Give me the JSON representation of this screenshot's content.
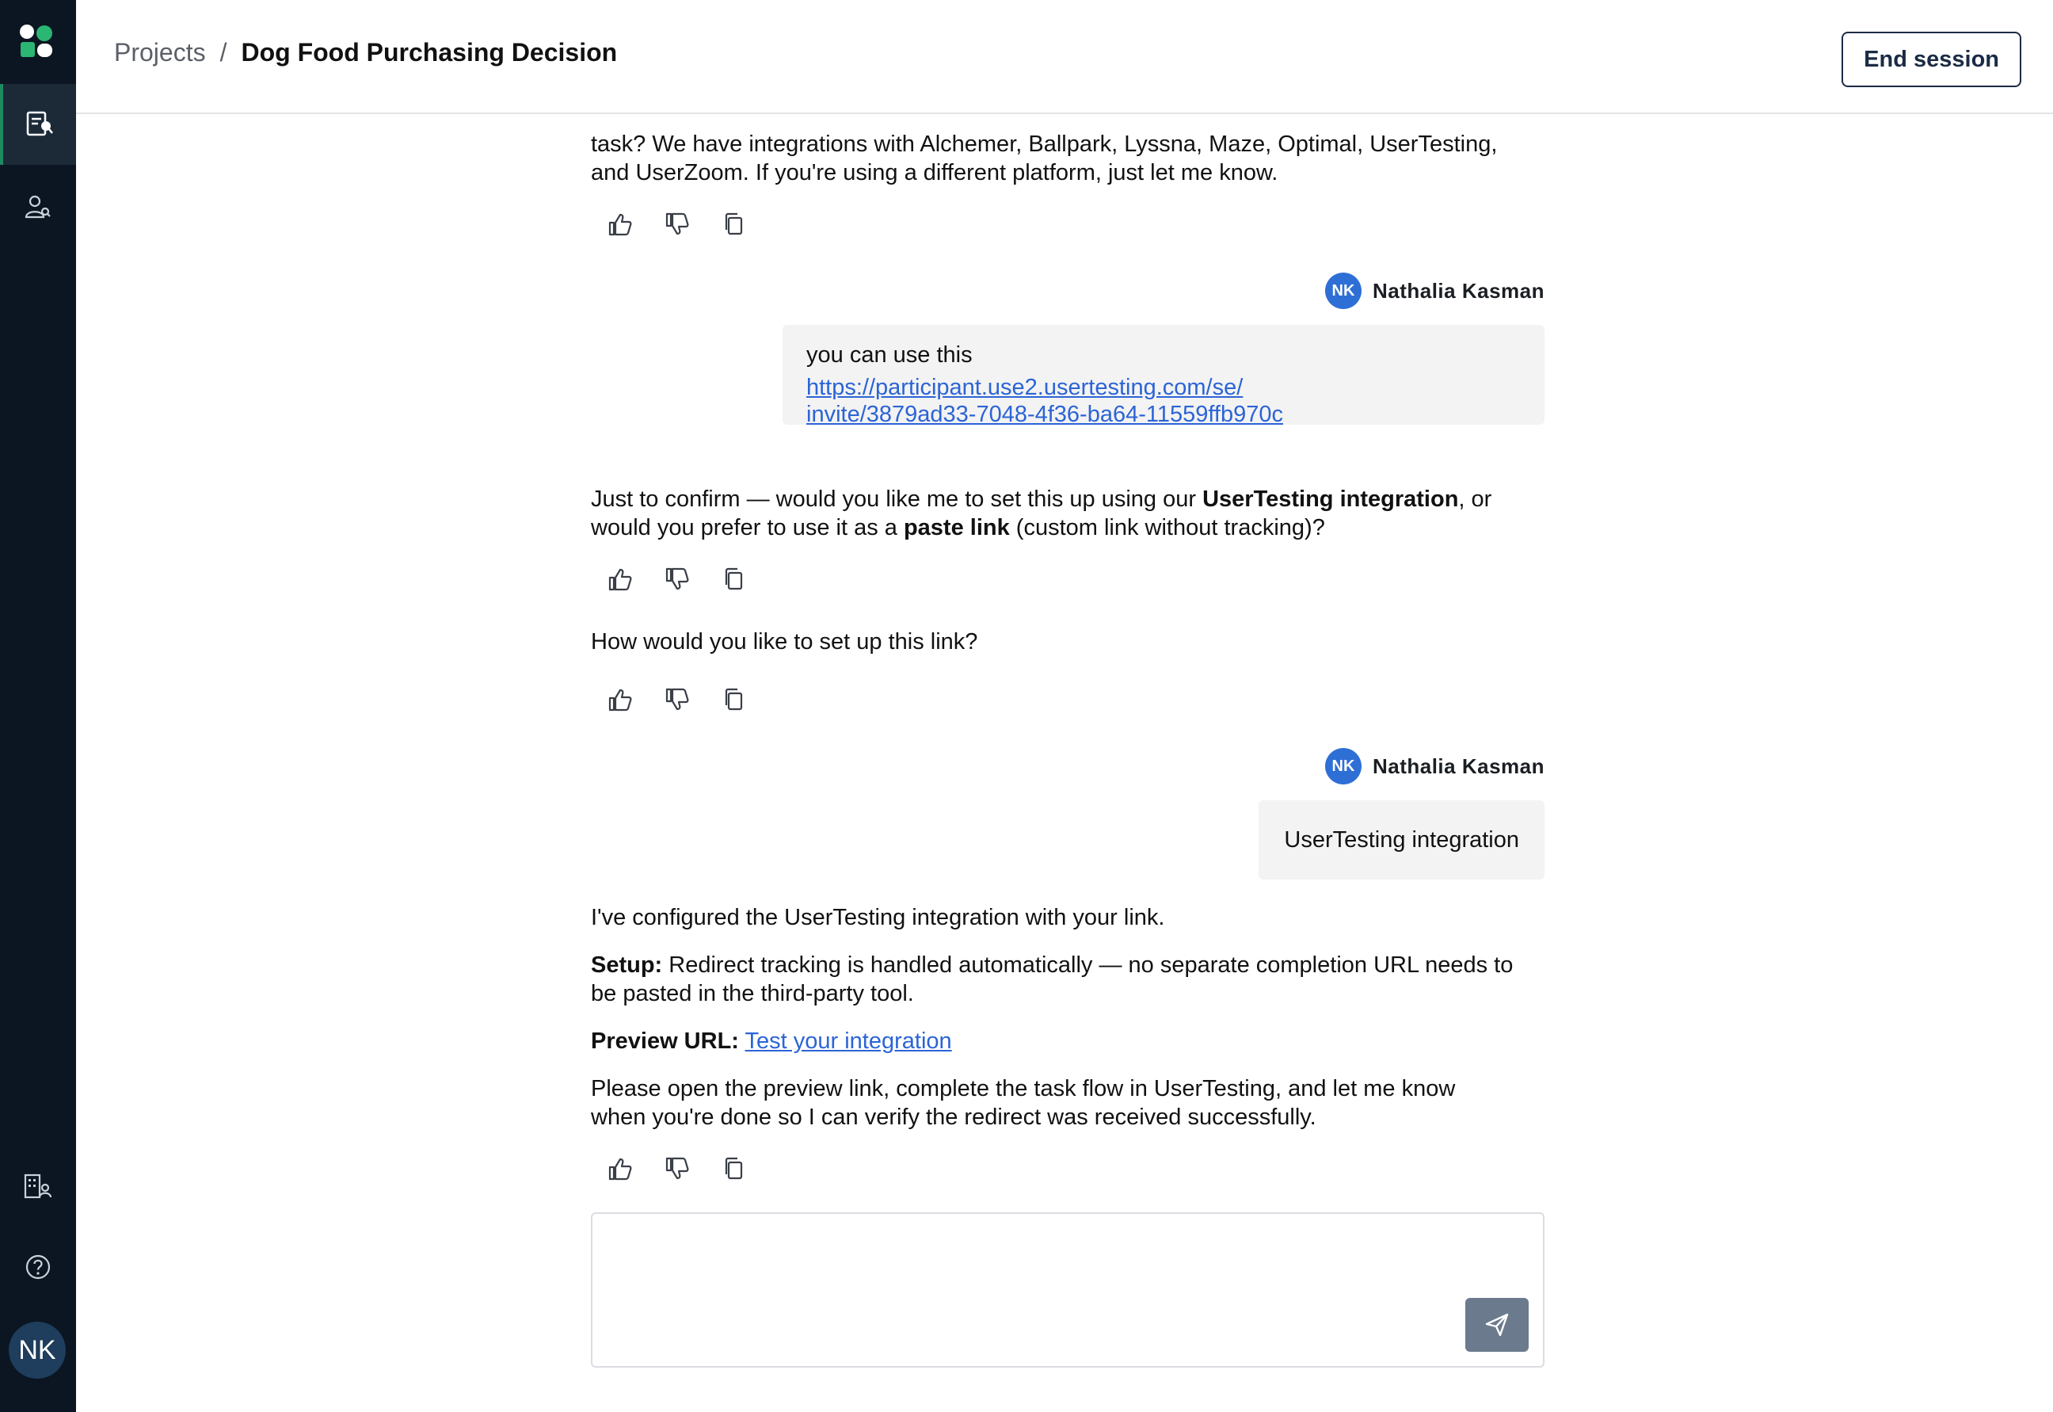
{
  "header": {
    "breadcrumb_root": "Projects",
    "breadcrumb_separator": "/",
    "title": "Dog Food Purchasing Decision",
    "end_session_label": "End session"
  },
  "sidebar": {
    "items": [
      {
        "icon": "studies-icon",
        "active": true
      },
      {
        "icon": "participants-icon",
        "active": false
      },
      {
        "icon": "organization-icon",
        "active": false
      },
      {
        "icon": "help-icon",
        "active": false
      }
    ],
    "avatar_initials": "NK"
  },
  "chat": {
    "msg1": {
      "line1": "task? We have integrations with Alchemer, Ballpark, Lyssna, Maze, Optimal, UserTesting,",
      "line2": "and UserZoom. If you're using a different platform, just let me know."
    },
    "user1": {
      "initials": "NK",
      "name": "Nathalia Kasman",
      "text": "you can use this",
      "link_line1": "https://participant.use2.usertesting.com/se/",
      "link_line2": "invite/3879ad33-7048-4f36-ba64-11559ffb970c"
    },
    "msg2": {
      "p1": "Just to confirm — would you like me to set this up using our ",
      "b1": "UserTesting integration",
      "p2": ", or",
      "p3": "would you prefer to use it as a ",
      "b2": "paste link",
      "p4": " (custom link without tracking)?"
    },
    "msg3": {
      "text": "How would you like to set up this link?"
    },
    "user2": {
      "initials": "NK",
      "name": "Nathalia Kasman",
      "text": "UserTesting integration"
    },
    "msg4": {
      "intro": "I've configured the UserTesting integration with your link.",
      "setup_label": "Setup:",
      "setup_line1": " Redirect tracking is handled automatically — no separate completion URL needs to",
      "setup_line2": "be pasted in the third-party tool.",
      "preview_label": "Preview URL:",
      "preview_link": "Test your integration",
      "outro_line1": "Please open the preview link, complete the task flow in UserTesting, and let me know",
      "outro_line2": "when you're done so I can verify the redirect was received successfully."
    }
  },
  "input": {
    "placeholder": ""
  },
  "colors": {
    "sidebar_bg": "#0b1622",
    "accent_green": "#1f8a5f",
    "link_blue": "#2b64d6",
    "avatar_blue": "#2e6fd6",
    "send_button": "#6b7a8c"
  }
}
